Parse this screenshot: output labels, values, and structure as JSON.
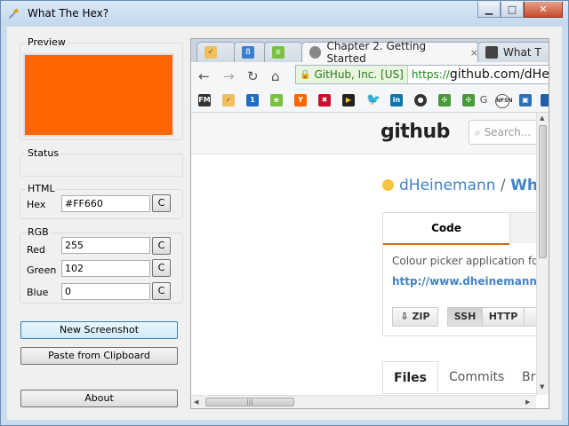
{
  "window": {
    "title": "What The Hex?",
    "min_icon": "minimize-icon",
    "max_icon": "maximize-icon",
    "close_icon": "close-icon"
  },
  "preview": {
    "label": "Preview",
    "color": "#FF6600"
  },
  "status": {
    "label": "Status",
    "text": ""
  },
  "html_group": {
    "label": "HTML",
    "hex_label": "Hex",
    "hex_value": "#FF660",
    "copy_label": "C"
  },
  "rgb_group": {
    "label": "RGB",
    "rows": [
      {
        "label": "Red",
        "value": "255",
        "copy_label": "C"
      },
      {
        "label": "Green",
        "value": "102",
        "copy_label": "C"
      },
      {
        "label": "Blue",
        "value": "0",
        "copy_label": "C"
      }
    ]
  },
  "buttons": {
    "new_screenshot": "New Screenshot",
    "paste": "Paste from Clipboard",
    "about": "About"
  },
  "browser": {
    "tabs": [
      {
        "title": "",
        "close": ""
      },
      {
        "title": "",
        "close": ""
      },
      {
        "title": "",
        "close": ""
      },
      {
        "title": "Chapter 2. Getting Started",
        "close": "×"
      },
      {
        "title": "What T",
        "close": ""
      }
    ],
    "ev_label": "GitHub, Inc. [US]",
    "url_scheme": "https://",
    "url_host": "github.com/dHe",
    "bookmark_G": "G",
    "github": {
      "logo": "github",
      "search_placeholder": "Search...",
      "owner": "dHeinemann",
      "separator": " / ",
      "repo": "What",
      "code_tab": "Code",
      "description": "Colour picker application for",
      "homepage": "http://www.dheinemann.c",
      "zip": "ZIP",
      "ssh": "SSH",
      "http": "HTTP",
      "files_tab": "Files",
      "commits_tab": "Commits",
      "branches_tab": "Bra"
    }
  }
}
